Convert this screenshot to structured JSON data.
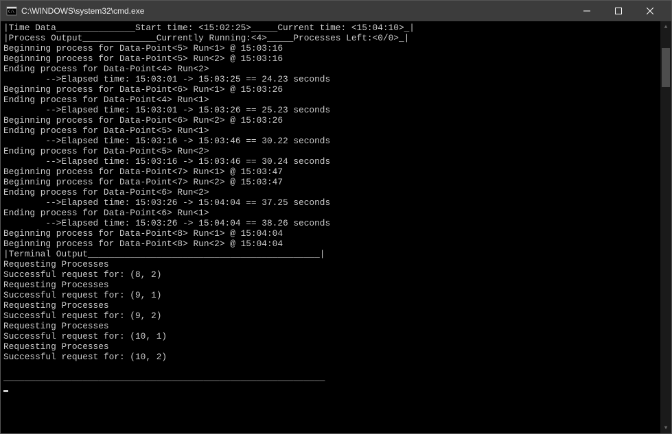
{
  "window": {
    "title": "C:\\WINDOWS\\system32\\cmd.exe"
  },
  "terminal": {
    "lines": [
      "|Time Data_______________Start time: <15:02:25>_____Current time: <15:04:10>_|",
      "|Process Output______________Currently Running:<4>_____Processes Left:<0/0>_|",
      "Beginning process for Data-Point<5> Run<1> @ 15:03:16",
      "Beginning process for Data-Point<5> Run<2> @ 15:03:16",
      "Ending process for Data-Point<4> Run<2>",
      "        -->Elapsed time: 15:03:01 -> 15:03:25 == 24.23 seconds",
      "Beginning process for Data-Point<6> Run<1> @ 15:03:26",
      "Ending process for Data-Point<4> Run<1>",
      "        -->Elapsed time: 15:03:01 -> 15:03:26 == 25.23 seconds",
      "Beginning process for Data-Point<6> Run<2> @ 15:03:26",
      "Ending process for Data-Point<5> Run<1>",
      "        -->Elapsed time: 15:03:16 -> 15:03:46 == 30.22 seconds",
      "Ending process for Data-Point<5> Run<2>",
      "        -->Elapsed time: 15:03:16 -> 15:03:46 == 30.24 seconds",
      "Beginning process for Data-Point<7> Run<1> @ 15:03:47",
      "Beginning process for Data-Point<7> Run<2> @ 15:03:47",
      "Ending process for Data-Point<6> Run<2>",
      "        -->Elapsed time: 15:03:26 -> 15:04:04 == 37.25 seconds",
      "Ending process for Data-Point<6> Run<1>",
      "        -->Elapsed time: 15:03:26 -> 15:04:04 == 38.26 seconds",
      "Beginning process for Data-Point<8> Run<1> @ 15:04:04",
      "Beginning process for Data-Point<8> Run<2> @ 15:04:04",
      "|Terminal Output____________________________________________|",
      "Requesting Processes",
      "Successful request for: (8, 2)",
      "Requesting Processes",
      "Successful request for: (9, 1)",
      "Requesting Processes",
      "Successful request for: (9, 2)",
      "Requesting Processes",
      "Successful request for: (10, 1)",
      "Requesting Processes",
      "Successful request for: (10, 2)",
      "",
      "_____________________________________________________________"
    ]
  }
}
